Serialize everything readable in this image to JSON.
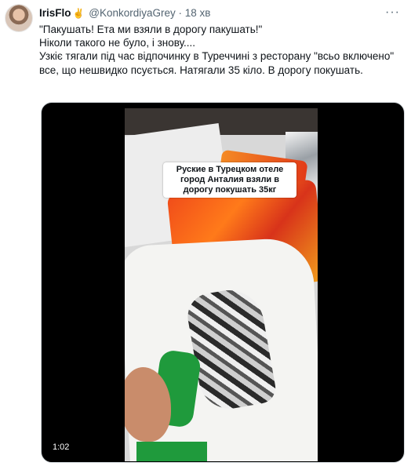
{
  "tweet": {
    "author_name": "IrisFlo",
    "author_emoji": "✌",
    "handle": "@KonkordiyaGrey",
    "separator": "·",
    "time": "18 хв",
    "more_icon": "more-dots-icon",
    "more_label": "···",
    "text_lines": [
      "\"Пакушать! Ета ми взяли в дорогу пакушать!\"",
      "Ніколи такого не було, і знову....",
      "Узкіє тягали під час відпочинку в Туреччині з ресторану \"всьо включено\" все, що нешвидко псується. Натягали 35 кіло. В дорогу покушать."
    ]
  },
  "media": {
    "video_caption": "Руские в Турецком отеле город Анталия взяли в дорогу покушать 35кг",
    "duration": "1:02"
  }
}
